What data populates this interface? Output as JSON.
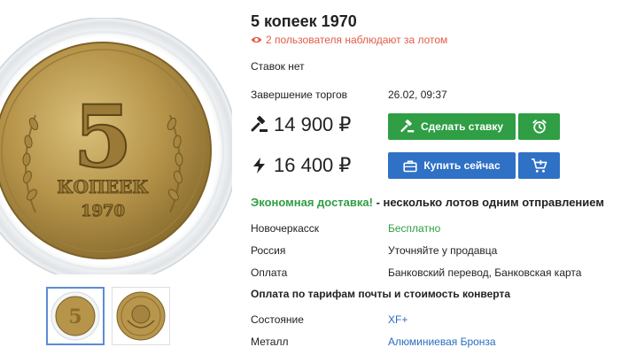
{
  "lot": {
    "title": "5 копеек 1970",
    "watchers": "2 пользователя наблюдают за лотом",
    "bids": "Ставок нет",
    "end_label": "Завершение торгов",
    "end_value": "26.02, 09:37"
  },
  "prices": {
    "bid_price": "14 900 ₽",
    "buy_price": "16 400 ₽"
  },
  "buttons": {
    "bid_label": "Сделать ставку",
    "buy_label": "Купить сейчас"
  },
  "delivery": {
    "highlight": "Экономная доставка!",
    "rest": " - несколько лотов одним отправлением"
  },
  "details": [
    {
      "label": "Новочеркасск",
      "value": "Бесплатно"
    },
    {
      "label": "Россия",
      "value": "Уточняйте у продавца"
    },
    {
      "label": "Оплата",
      "value": "Банковский перевод, Банковская карта"
    }
  ],
  "shipping_note": "Оплата по тарифам почты и стоимость конверта",
  "attributes": [
    {
      "label": "Состояние",
      "value": "XF+"
    },
    {
      "label": "Металл",
      "value": "Алюминиевая Бронза"
    }
  ],
  "coin": {
    "denomination": "5",
    "word": "КОПЕЕК",
    "year": "1970"
  },
  "colors": {
    "accent_green": "#2f9e44",
    "accent_blue": "#2f71c5",
    "watch_red": "#e15b46",
    "link_blue": "#2a6dc0"
  }
}
